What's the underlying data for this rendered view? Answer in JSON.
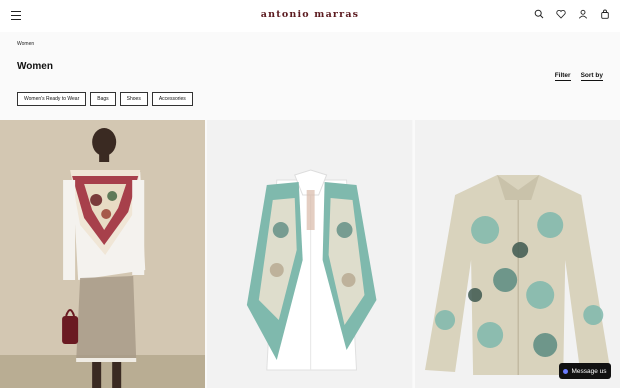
{
  "header": {
    "brand": "antonio marras",
    "icons": [
      "menu-icon",
      "search-icon",
      "heart-icon",
      "user-icon",
      "bag-icon"
    ]
  },
  "breadcrumb": "Women",
  "page": {
    "title": "Women",
    "filter_label": "Filter",
    "sort_label": "Sort by"
  },
  "categories": [
    "Women's Ready to Wear",
    "Bags",
    "Shoes",
    "Accessories"
  ],
  "chat": {
    "label": "Message us",
    "accent": "#6b7cff"
  },
  "colors": {
    "brand": "#5b1a1f",
    "print_teal": "#7fb9ad",
    "print_red": "#9a2233"
  }
}
